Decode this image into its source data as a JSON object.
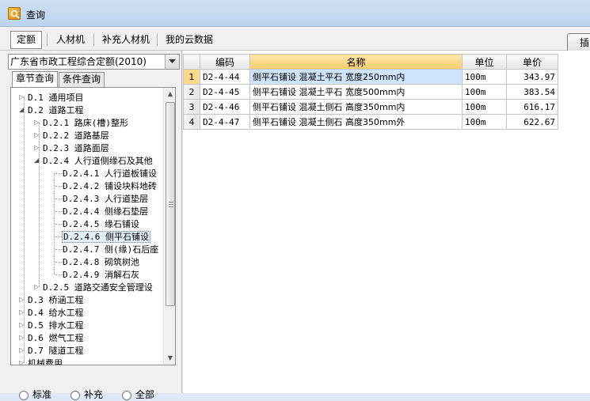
{
  "window": {
    "title": "查询"
  },
  "tabs": [
    {
      "label": "定额",
      "active": true
    },
    {
      "label": "人材机",
      "active": false
    },
    {
      "label": "补充人材机",
      "active": false
    },
    {
      "label": "我的云数据",
      "active": false
    }
  ],
  "insert_button": {
    "label": "插"
  },
  "library_select": {
    "value": "广东省市政工程综合定额(2010)"
  },
  "subtabs": [
    {
      "label": "章节查询",
      "active": true
    },
    {
      "label": "条件查询",
      "active": false
    }
  ],
  "tree": [
    {
      "label": "D.1 通用项目"
    },
    {
      "label": "D.2 道路工程"
    },
    {
      "label": "D.2.1 路床(槽)整形"
    },
    {
      "label": "D.2.2 道路基层"
    },
    {
      "label": "D.2.3 道路面层"
    },
    {
      "label": "D.2.4 人行道侧缘石及其他"
    },
    {
      "label": "D.2.4.1 人行道板铺设"
    },
    {
      "label": "D.2.4.2 铺设块料地砖"
    },
    {
      "label": "D.2.4.3 人行道垫层"
    },
    {
      "label": "D.2.4.4 侧缘石垫层"
    },
    {
      "label": "D.2.4.5 缘石铺设"
    },
    {
      "label": "D.2.4.6 侧平石铺设"
    },
    {
      "label": "D.2.4.7 侧(缘)石后座"
    },
    {
      "label": "D.2.4.8 砌筑树池"
    },
    {
      "label": "D.2.4.9 消解石灰"
    },
    {
      "label": "D.2.5 道路交通安全管理设"
    },
    {
      "label": "D.3 桥涵工程"
    },
    {
      "label": "D.4 给水工程"
    },
    {
      "label": "D.5 排水工程"
    },
    {
      "label": "D.6 燃气工程"
    },
    {
      "label": "D.7 隧道工程"
    },
    {
      "label": "机械费用"
    }
  ],
  "radios": [
    {
      "label": "标准"
    },
    {
      "label": "补充"
    },
    {
      "label": "全部"
    }
  ],
  "grid": {
    "headers": [
      "",
      "编码",
      "名称",
      "单位",
      "单价"
    ],
    "rows": [
      {
        "no": "1",
        "code": "D2-4-44",
        "name": "侧平石铺设 混凝土平石 宽度250mm内",
        "unit": "100m",
        "price": "343.97"
      },
      {
        "no": "2",
        "code": "D2-4-45",
        "name": "侧平石铺设 混凝土平石 宽度500mm内",
        "unit": "100m",
        "price": "383.54"
      },
      {
        "no": "3",
        "code": "D2-4-46",
        "name": "侧平石铺设 混凝土侧石 高度350mm内",
        "unit": "100m",
        "price": "616.17"
      },
      {
        "no": "4",
        "code": "D2-4-47",
        "name": "侧平石铺设 混凝土侧石 高度350mm外",
        "unit": "100m",
        "price": "622.67"
      }
    ]
  }
}
